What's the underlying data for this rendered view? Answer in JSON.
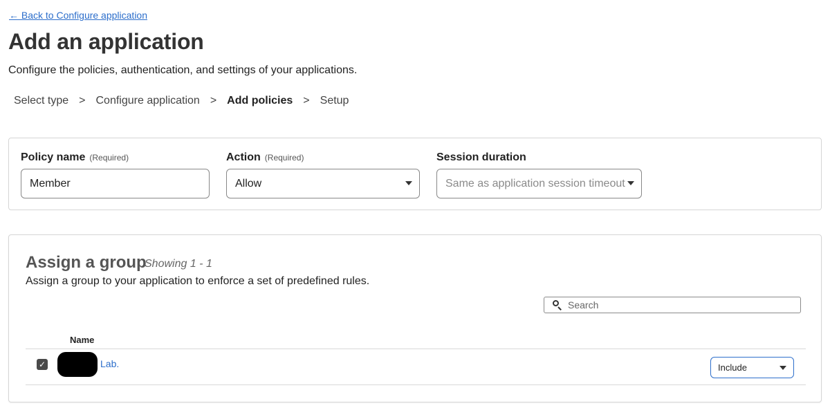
{
  "nav": {
    "back_link": "← Back to Configure application"
  },
  "header": {
    "title": "Add an application",
    "subtitle": "Configure the policies, authentication, and settings of your applications."
  },
  "stepper": {
    "steps": [
      {
        "label": "Select type",
        "active": false
      },
      {
        "label": "Configure application",
        "active": false
      },
      {
        "label": "Add policies",
        "active": true
      },
      {
        "label": "Setup",
        "active": false
      }
    ],
    "separator": ">"
  },
  "policy": {
    "name_label": "Policy name",
    "name_required": "(Required)",
    "name_value": "Member",
    "action_label": "Action",
    "action_required": "(Required)",
    "action_value": "Allow",
    "session_label": "Session duration",
    "session_placeholder": "Same as application session timeout"
  },
  "group": {
    "title": "Assign a group",
    "showing": "Showing 1 - 1",
    "description": "Assign a group to your application to enforce a set of predefined rules.",
    "search_placeholder": "Search",
    "column_name": "Name",
    "rows": [
      {
        "name": "Lab.",
        "checked": true,
        "rule": "Include"
      }
    ]
  },
  "icons": {
    "search": "search-icon",
    "dropdown": "chevron-down-icon",
    "checkbox": "checkmark-icon"
  },
  "colors": {
    "link": "#2c6ecb",
    "border": "#d5d5d5",
    "title": "#333333"
  }
}
